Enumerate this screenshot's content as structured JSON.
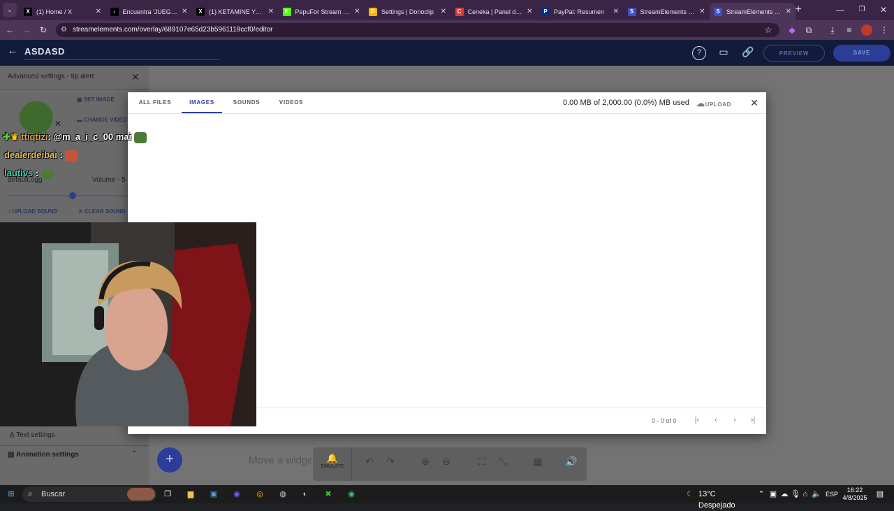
{
  "browser": {
    "tabs": [
      {
        "label": "(1) Home / X",
        "icon": "x-logo-icon",
        "color": "#000000"
      },
      {
        "label": "Encuentra 'JUEGO M…",
        "icon": "tiktok-logo-icon",
        "color": "#000000"
      },
      {
        "label": "(1) KETAMINE YAMAL…",
        "icon": "x-logo-icon",
        "color": "#000000"
      },
      {
        "label": "PepuFor Stream - Wa…",
        "icon": "kick-logo-icon",
        "color": "#53fc18"
      },
      {
        "label": "Settings | Donoclip",
        "icon": "donoclip-logo-icon",
        "color": "#f5b400"
      },
      {
        "label": "Ceneka | Panel de co…",
        "icon": "ceneka-logo-icon",
        "color": "#e53935"
      },
      {
        "label": "PayPal: Resumen",
        "icon": "paypal-logo-icon",
        "color": "#003087"
      },
      {
        "label": "StreamElements - Ov…",
        "icon": "streamelements-logo-icon",
        "color": "#3d50c8"
      },
      {
        "label": "StreamElements - pr…",
        "icon": "streamelements-logo-icon",
        "color": "#3d50c8"
      }
    ],
    "url": "streamelements.com/overlay/689107e65d23b5961119ccf0/editor"
  },
  "editor": {
    "project_name": "ASDASD",
    "preview_label": "PREVIEW",
    "save_label": "SAVE",
    "accent": "#3d50c8"
  },
  "side_panel": {
    "title": "Advanced settings - tip alert",
    "set_image": "SET IMAGE",
    "change_video": "CHANGE VIDEO",
    "sound_file": "default.ogg",
    "volume_label": "Volume - 5",
    "upload_sound": "UPLOAD SOUND",
    "clear_sound": "CLEAR SOUND",
    "text_settings": "Text settings",
    "animation_settings": "Animation settings"
  },
  "chat_overlay": {
    "line1_user": "ttiqtizi",
    "line1_msg": ": @m_a_i_c_00 mai",
    "line2_user": "dealerdeibai",
    "line2_msg": ":",
    "line3_user": "lautivs",
    "line3_msg": ":"
  },
  "media_dialog": {
    "tabs": [
      "ALL FILES",
      "IMAGES",
      "SOUNDS",
      "VIDEOS"
    ],
    "active_tab": "IMAGES",
    "usage": "0.00 MB of 2,000.00 (0.0%) MB used",
    "upload_label": "UPLOAD",
    "pagination": "0 - 0 of 0"
  },
  "canvas": {
    "placeholder": "Move a widget",
    "emulate_label": "EMULATE"
  },
  "taskbar": {
    "search_label": "Buscar",
    "weather": "13°C Despejado",
    "language": "ESP",
    "time": "16:22",
    "date": "4/8/2025"
  }
}
